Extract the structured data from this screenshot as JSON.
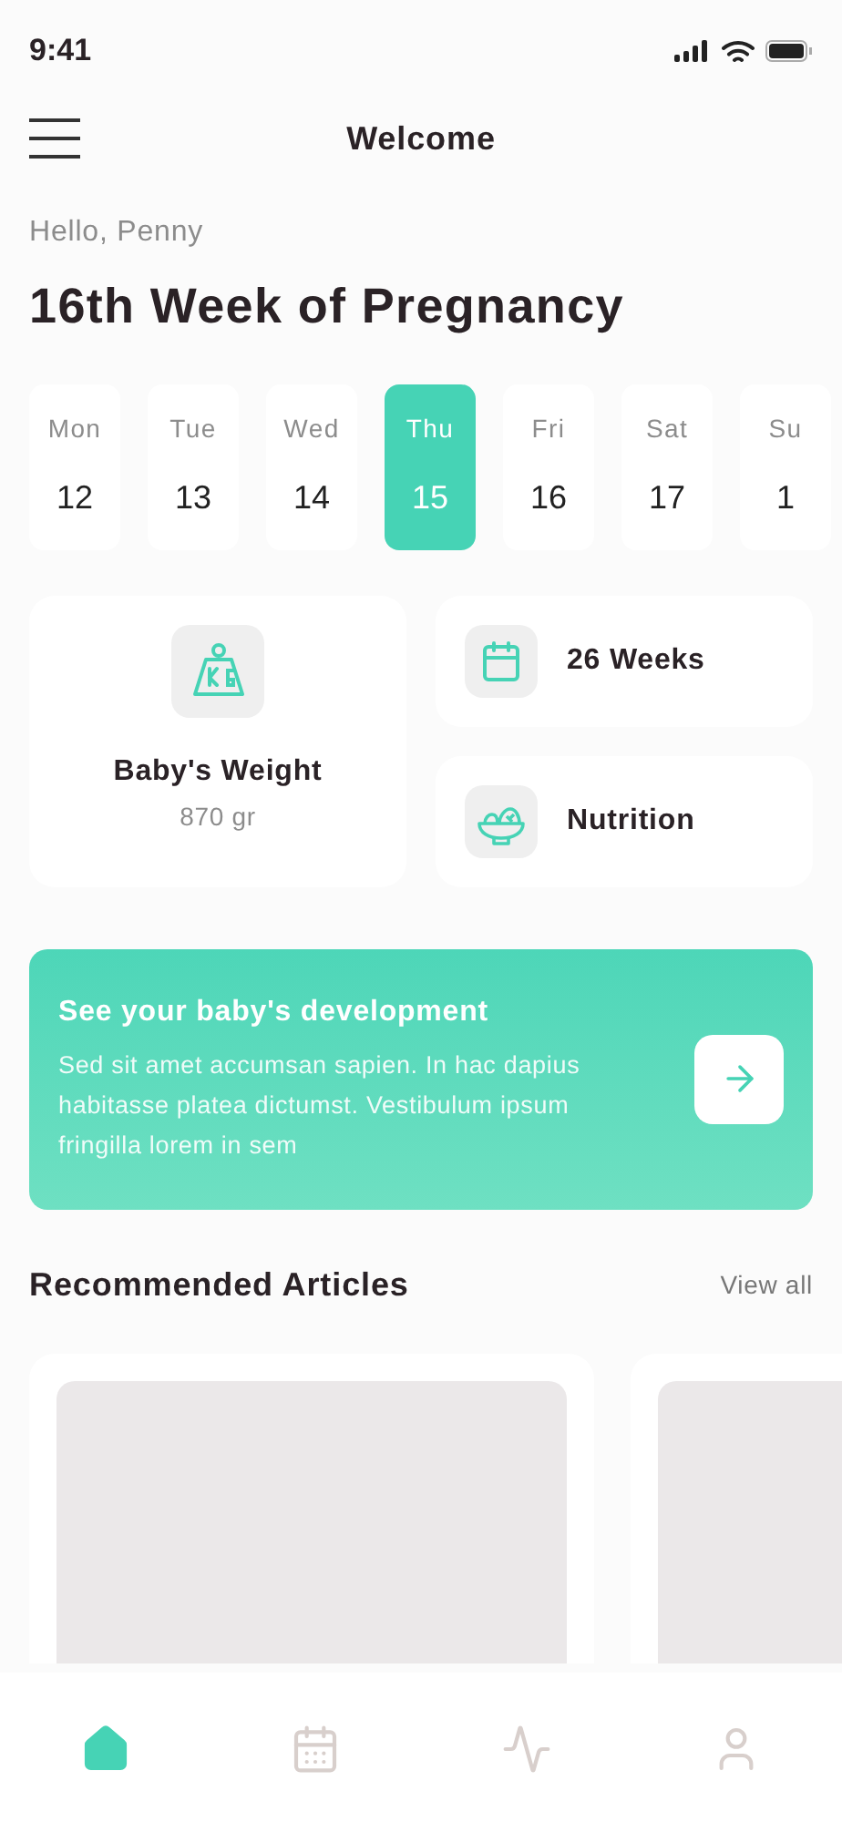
{
  "status_bar": {
    "time": "9:41"
  },
  "header": {
    "title": "Welcome"
  },
  "greeting": "Hello, Penny",
  "headline": "16th Week of Pregnancy",
  "days": [
    {
      "name": "Mon",
      "date": "12",
      "selected": false
    },
    {
      "name": "Tue",
      "date": "13",
      "selected": false
    },
    {
      "name": "Wed",
      "date": "14",
      "selected": false
    },
    {
      "name": "Thu",
      "date": "15",
      "selected": true
    },
    {
      "name": "Fri",
      "date": "16",
      "selected": false
    },
    {
      "name": "Sat",
      "date": "17",
      "selected": false
    },
    {
      "name": "Su",
      "date": "1",
      "selected": false
    }
  ],
  "weight_card": {
    "title": "Baby's Weight",
    "value": "870 gr"
  },
  "info_cards": [
    {
      "kind": "weeks",
      "label": "26 Weeks"
    },
    {
      "kind": "nutrition",
      "label": "Nutrition"
    }
  ],
  "banner": {
    "title": "See your baby's development",
    "text": "Sed sit amet accumsan sapien. In hac dapius habitasse platea dictumst. Vestibulum ipsum fringilla lorem in sem"
  },
  "articles": {
    "title": "Recommended Articles",
    "link": "View all"
  },
  "nav": [
    {
      "kind": "home",
      "selected": true
    },
    {
      "kind": "calendar",
      "selected": false
    },
    {
      "kind": "activity",
      "selected": false
    },
    {
      "kind": "profile",
      "selected": false
    }
  ]
}
